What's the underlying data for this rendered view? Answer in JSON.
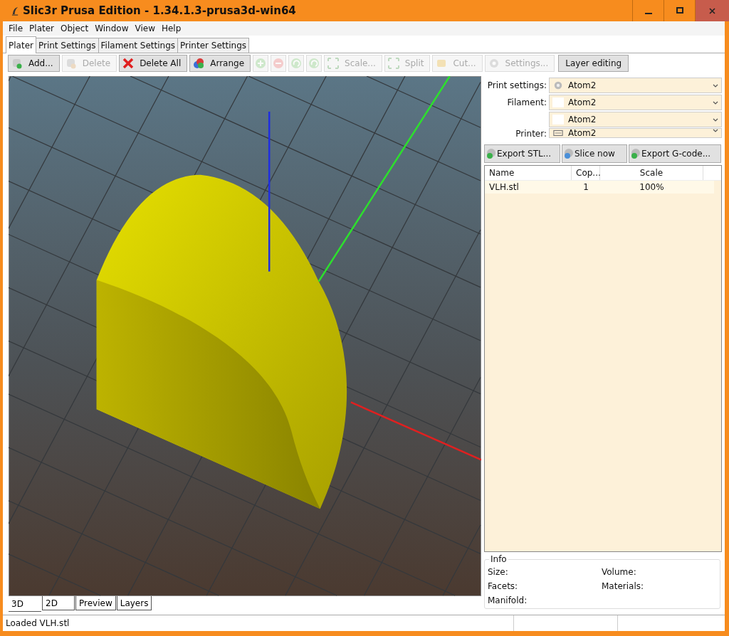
{
  "window": {
    "title": "Slic3r Prusa Edition - 1.34.1.3-prusa3d-win64"
  },
  "menu": [
    "File",
    "Plater",
    "Object",
    "Window",
    "View",
    "Help"
  ],
  "tabs": [
    {
      "label": "Plater",
      "selected": true
    },
    {
      "label": "Print Settings",
      "selected": false
    },
    {
      "label": "Filament Settings",
      "selected": false
    },
    {
      "label": "Printer Settings",
      "selected": false
    }
  ],
  "toolbar": [
    {
      "kind": "text",
      "label": "Add...",
      "disabled": false
    },
    {
      "kind": "text",
      "label": "Delete",
      "disabled": true
    },
    {
      "kind": "text",
      "label": "Delete All",
      "disabled": false
    },
    {
      "kind": "text",
      "label": "Arrange",
      "disabled": false
    },
    {
      "kind": "icon",
      "disabled": true
    },
    {
      "kind": "icon",
      "disabled": true
    },
    {
      "kind": "icon",
      "disabled": true
    },
    {
      "kind": "icon",
      "disabled": true
    },
    {
      "kind": "text",
      "label": "Scale...",
      "disabled": true
    },
    {
      "kind": "text",
      "label": "Split",
      "disabled": true
    },
    {
      "kind": "text",
      "label": "Cut...",
      "disabled": true
    },
    {
      "kind": "text",
      "label": "Settings...",
      "disabled": true
    },
    {
      "kind": "plain",
      "label": "Layer editing",
      "disabled": false
    }
  ],
  "view_tabs": [
    {
      "label": "3D",
      "selected": true
    },
    {
      "label": "2D",
      "selected": false
    },
    {
      "label": "Preview",
      "selected": false
    },
    {
      "label": "Layers",
      "selected": false
    }
  ],
  "presets": [
    {
      "label": "Print settings:",
      "value": "Atom2"
    },
    {
      "label": "Filament:",
      "value": "Atom2"
    },
    {
      "value": "Atom2"
    },
    {
      "label": "Printer:",
      "value": "Atom2"
    }
  ],
  "actions": [
    "Export STL...",
    "Slice now",
    "Export G-code..."
  ],
  "table": {
    "columns": [
      "Name",
      "Cop...",
      "Scale"
    ],
    "rows": [
      [
        "VLH.stl",
        "1",
        "100%"
      ]
    ]
  },
  "info": {
    "title": "Info",
    "fields": [
      "Size:",
      "Volume:",
      "Facets:",
      "Materials:",
      "Manifold:"
    ]
  },
  "status_bar": "Loaded VLH.stl"
}
